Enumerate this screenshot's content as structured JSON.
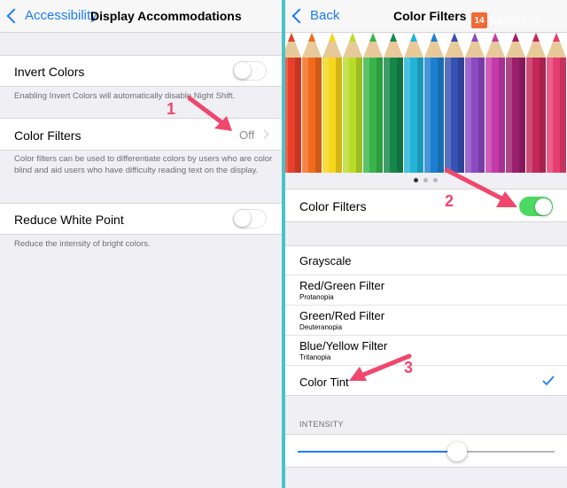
{
  "left": {
    "nav": {
      "back_label": "Accessibility",
      "title": "Display Accommodations"
    },
    "invert_colors": {
      "label": "Invert Colors",
      "footnote": "Enabling Invert Colors will automatically disable Night Shift."
    },
    "color_filters": {
      "label": "Color Filters",
      "value": "Off",
      "footnote": "Color filters can be used to differentiate colors by users who are color blind and aid users who have difficulty reading text on the display."
    },
    "reduce_white_point": {
      "label": "Reduce White Point",
      "footnote": "Reduce the intensity of bright colors."
    }
  },
  "right": {
    "nav": {
      "back_label": "Back",
      "title": "Color Filters"
    },
    "watermark": {
      "badge": "14",
      "text": "Kenh14.vn"
    },
    "color_filters_toggle_label": "Color Filters",
    "filters": [
      {
        "title": "Grayscale",
        "subtitle": ""
      },
      {
        "title": "Red/Green Filter",
        "subtitle": "Protanopia"
      },
      {
        "title": "Green/Red Filter",
        "subtitle": "Deuteranopia"
      },
      {
        "title": "Blue/Yellow Filter",
        "subtitle": "Tritanopia"
      },
      {
        "title": "Color Tint",
        "subtitle": "",
        "selected": true
      }
    ],
    "intensity_label": "INTENSITY",
    "intensity_value": 0.62,
    "page_indicator": {
      "count": 3,
      "active": 0
    }
  },
  "annotations": [
    "1",
    "2",
    "3"
  ],
  "colors": {
    "accent": "#1b7cf4",
    "toggle_on": "#4cd964",
    "annotation": "#f0476c",
    "divider": "#49c3c6",
    "pencils": [
      "#e8402a",
      "#f26b1d",
      "#f7d51c",
      "#b9dc2a",
      "#38b54a",
      "#16874a",
      "#22b3d7",
      "#1d7fd1",
      "#3551b2",
      "#8b49c2",
      "#c53aaa",
      "#9c1f6b",
      "#c4275a",
      "#e73c6f"
    ]
  },
  "icons": {
    "back": "chevron-left-icon",
    "disclosure": "chevron-right-icon",
    "check": "checkmark-icon"
  }
}
